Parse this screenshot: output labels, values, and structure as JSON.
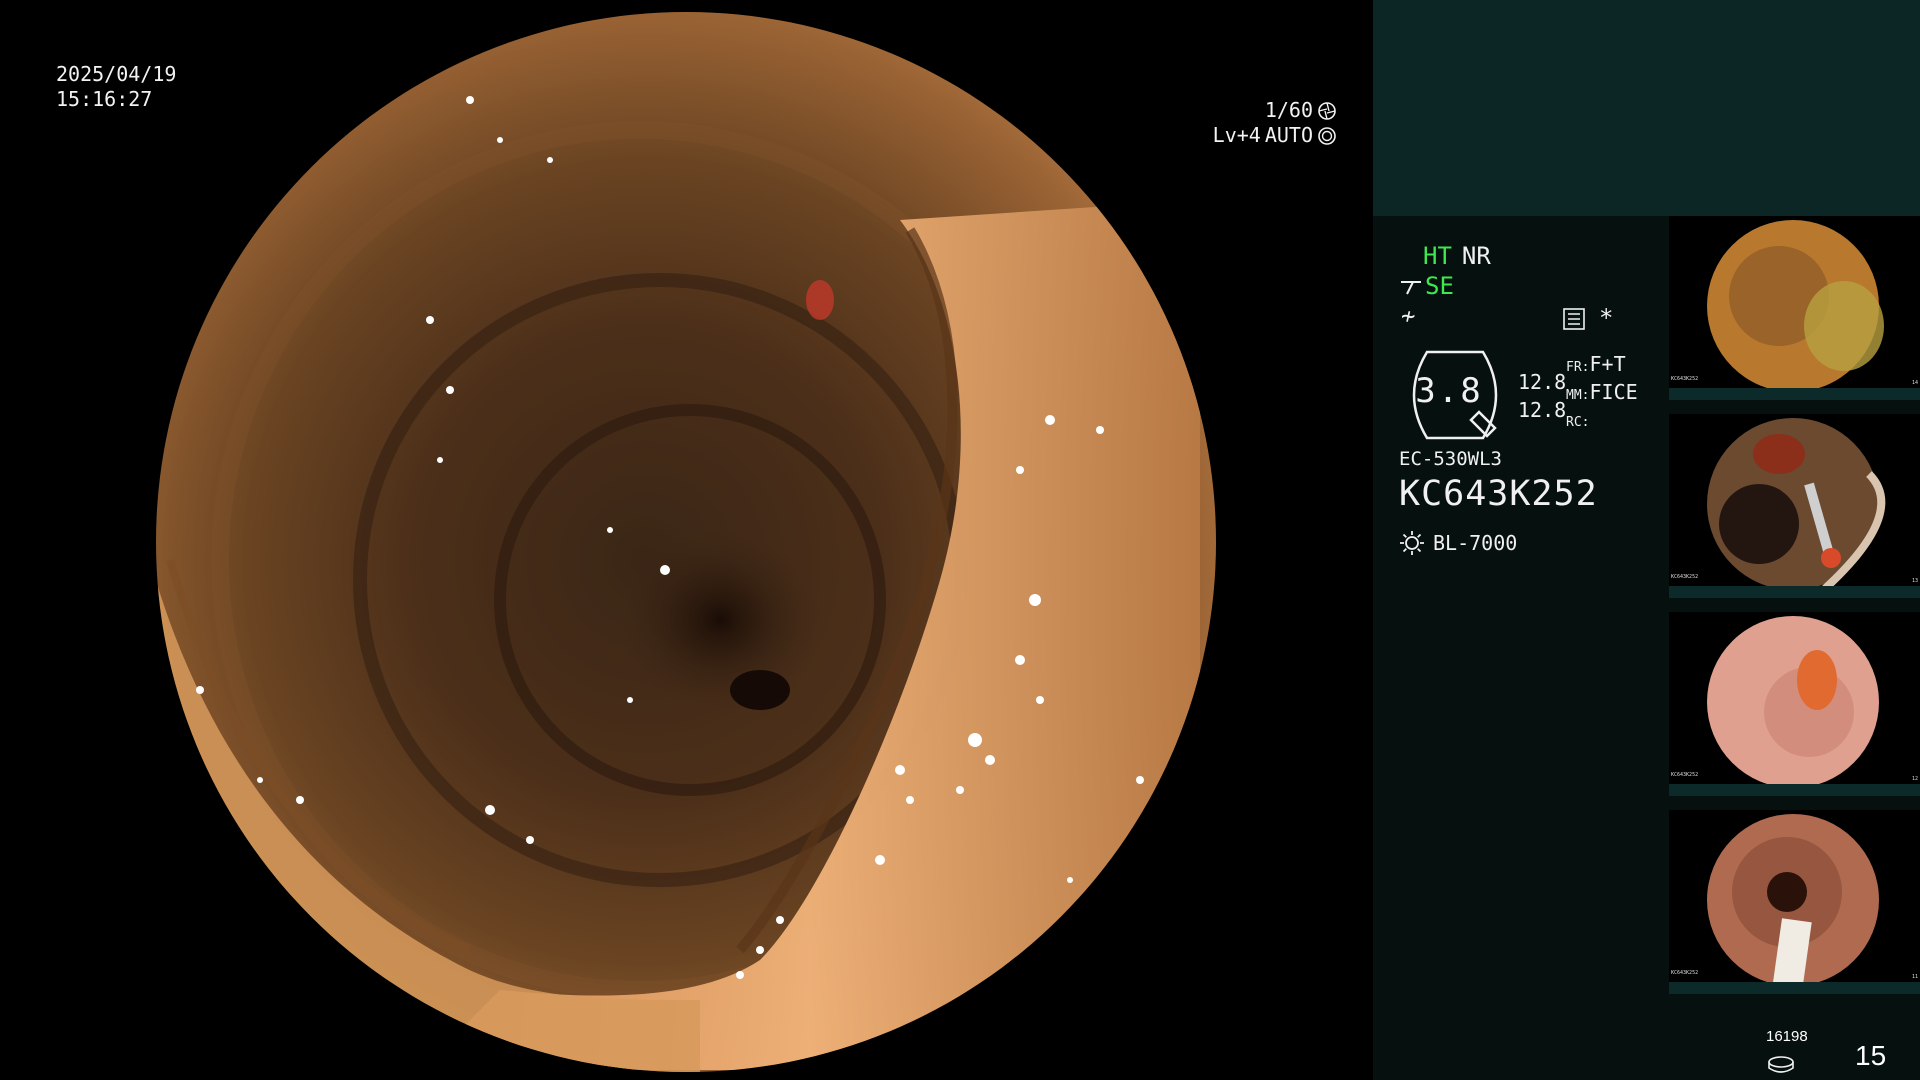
{
  "osd": {
    "date": "2025/04/19",
    "time": "15:16:27",
    "shutter": "1/60",
    "level": "Lv+4",
    "exposure": "AUTO"
  },
  "panel": {
    "ht": "HT",
    "nr": "NR",
    "se": "SE",
    "ne_symbol": "≁",
    "star": "*",
    "zoom": "3.8",
    "value_a": "12.8",
    "value_b": "12.8",
    "fr_label": "FR:",
    "fr_value": "F+T",
    "mm_label": "MM:",
    "mm_value": "FICE",
    "rc_label": "RC:",
    "scope_model": "EC-530WL3",
    "scope_serial": "KC643K252",
    "light_source": "BL-7000",
    "storage_count": "16198",
    "page_number": "15"
  },
  "thumbnails": [
    {
      "serial": "KC643K252",
      "index": "14"
    },
    {
      "serial": "KC643K252",
      "index": "13"
    },
    {
      "serial": "KC643K252",
      "index": "12"
    },
    {
      "serial": "KC643K252",
      "index": "11"
    }
  ],
  "icons": [
    "shutter-icon",
    "aperture-icon",
    "scope-angle-icon",
    "menu-list-icon",
    "zoom-badge-icon",
    "lightbulb-icon",
    "storage-icon"
  ],
  "colors": {
    "side_top_bg": "#0c2626",
    "side_panel_bg": "#06100f",
    "status_green": "#3ee84f",
    "tissue_light": "#e8a468",
    "tissue_dark": "#3a2414"
  }
}
